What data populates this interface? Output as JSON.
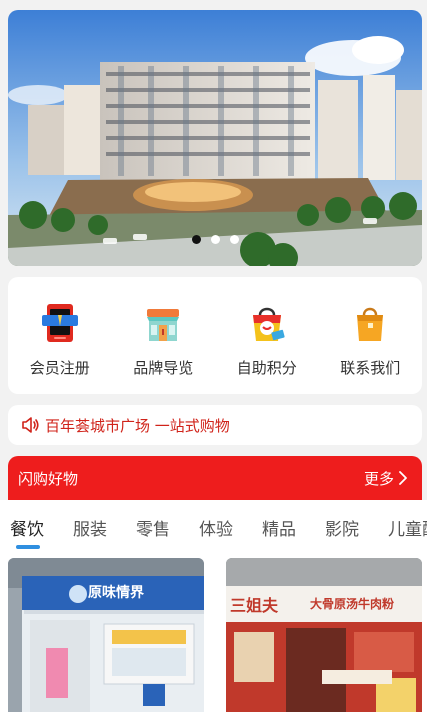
{
  "banner": {
    "slides": 3,
    "active_slide": 1
  },
  "quick_menu": [
    {
      "label": "会员注册",
      "icon": "member-card-icon"
    },
    {
      "label": "品牌导览",
      "icon": "storefront-icon"
    },
    {
      "label": "自助积分",
      "icon": "shopping-bag-icon"
    },
    {
      "label": "联系我们",
      "icon": "gift-bag-icon"
    }
  ],
  "notice": {
    "text": "百年荟城市广场 一站式购物"
  },
  "flash_sale": {
    "title": "闪购好物",
    "more": "更多"
  },
  "tabs": [
    "餐饮",
    "服装",
    "零售",
    "体验",
    "精品",
    "影院",
    "儿童配套"
  ],
  "active_tab": 0,
  "cards": [
    {
      "shop_sign": "原味情界"
    },
    {
      "shop_sign_left": "三姐夫",
      "shop_sign_right": "大骨原汤牛肉粉"
    }
  ],
  "colors": {
    "accent_red": "#ee1d1d",
    "notice_red": "#d0231a",
    "tab_indicator": "#2f8fe0"
  }
}
